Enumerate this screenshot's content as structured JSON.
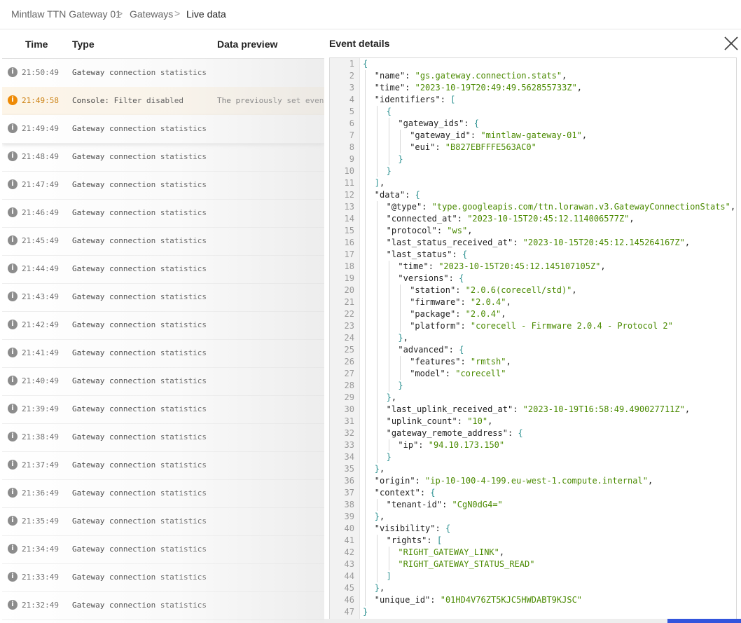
{
  "breadcrumb": {
    "items": [
      "Mintlaw TTN Gateway 01",
      "Gateways",
      "Live data"
    ],
    "separator": ">"
  },
  "table": {
    "columns": [
      "Time",
      "Type",
      "Data preview"
    ],
    "rows": [
      {
        "icon": "i",
        "time": "21:50:49",
        "type": "Gateway connection statistics",
        "preview": "",
        "state": "normal"
      },
      {
        "icon": "i",
        "time": "21:49:58",
        "type": "Console: Filter disabled",
        "preview": "The previously set event filter",
        "state": "warning"
      },
      {
        "icon": "i",
        "time": "21:49:49",
        "type": "Gateway connection statistics",
        "preview": "",
        "state": "selected"
      },
      {
        "icon": "i",
        "time": "21:48:49",
        "type": "Gateway connection statistics",
        "preview": "",
        "state": "normal"
      },
      {
        "icon": "i",
        "time": "21:47:49",
        "type": "Gateway connection statistics",
        "preview": "",
        "state": "normal"
      },
      {
        "icon": "i",
        "time": "21:46:49",
        "type": "Gateway connection statistics",
        "preview": "",
        "state": "normal"
      },
      {
        "icon": "i",
        "time": "21:45:49",
        "type": "Gateway connection statistics",
        "preview": "",
        "state": "normal"
      },
      {
        "icon": "i",
        "time": "21:44:49",
        "type": "Gateway connection statistics",
        "preview": "",
        "state": "normal"
      },
      {
        "icon": "i",
        "time": "21:43:49",
        "type": "Gateway connection statistics",
        "preview": "",
        "state": "normal"
      },
      {
        "icon": "i",
        "time": "21:42:49",
        "type": "Gateway connection statistics",
        "preview": "",
        "state": "normal"
      },
      {
        "icon": "i",
        "time": "21:41:49",
        "type": "Gateway connection statistics",
        "preview": "",
        "state": "normal"
      },
      {
        "icon": "i",
        "time": "21:40:49",
        "type": "Gateway connection statistics",
        "preview": "",
        "state": "normal"
      },
      {
        "icon": "i",
        "time": "21:39:49",
        "type": "Gateway connection statistics",
        "preview": "",
        "state": "normal"
      },
      {
        "icon": "i",
        "time": "21:38:49",
        "type": "Gateway connection statistics",
        "preview": "",
        "state": "normal"
      },
      {
        "icon": "i",
        "time": "21:37:49",
        "type": "Gateway connection statistics",
        "preview": "",
        "state": "normal"
      },
      {
        "icon": "i",
        "time": "21:36:49",
        "type": "Gateway connection statistics",
        "preview": "",
        "state": "normal"
      },
      {
        "icon": "i",
        "time": "21:35:49",
        "type": "Gateway connection statistics",
        "preview": "",
        "state": "normal"
      },
      {
        "icon": "i",
        "time": "21:34:49",
        "type": "Gateway connection statistics",
        "preview": "",
        "state": "normal"
      },
      {
        "icon": "i",
        "time": "21:33:49",
        "type": "Gateway connection statistics",
        "preview": "",
        "state": "normal"
      },
      {
        "icon": "i",
        "time": "21:32:49",
        "type": "Gateway connection statistics",
        "preview": "",
        "state": "normal"
      }
    ]
  },
  "panel": {
    "title": "Event details",
    "close_icon": "close-icon",
    "json_lines": [
      {
        "n": 1,
        "indent": 0,
        "t": [
          [
            "p",
            "{"
          ]
        ]
      },
      {
        "n": 2,
        "indent": 1,
        "t": [
          [
            "k",
            "\"name\""
          ],
          [
            "k",
            ": "
          ],
          [
            "s",
            "\"gs.gateway.connection.stats\""
          ],
          [
            "k",
            ","
          ]
        ]
      },
      {
        "n": 3,
        "indent": 1,
        "t": [
          [
            "k",
            "\"time\""
          ],
          [
            "k",
            ": "
          ],
          [
            "s",
            "\"2023-10-19T20:49:49.562855733Z\""
          ],
          [
            "k",
            ","
          ]
        ]
      },
      {
        "n": 4,
        "indent": 1,
        "t": [
          [
            "k",
            "\"identifiers\""
          ],
          [
            "k",
            ": "
          ],
          [
            "p",
            "["
          ]
        ]
      },
      {
        "n": 5,
        "indent": 2,
        "t": [
          [
            "p",
            "{"
          ]
        ]
      },
      {
        "n": 6,
        "indent": 3,
        "t": [
          [
            "k",
            "\"gateway_ids\""
          ],
          [
            "k",
            ": "
          ],
          [
            "p",
            "{"
          ]
        ]
      },
      {
        "n": 7,
        "indent": 4,
        "t": [
          [
            "k",
            "\"gateway_id\""
          ],
          [
            "k",
            ": "
          ],
          [
            "s",
            "\"mintlaw-gateway-01\""
          ],
          [
            "k",
            ","
          ]
        ]
      },
      {
        "n": 8,
        "indent": 4,
        "t": [
          [
            "k",
            "\"eui\""
          ],
          [
            "k",
            ": "
          ],
          [
            "s",
            "\"B827EBFFFE563AC0\""
          ]
        ]
      },
      {
        "n": 9,
        "indent": 3,
        "t": [
          [
            "p",
            "}"
          ]
        ]
      },
      {
        "n": 10,
        "indent": 2,
        "t": [
          [
            "p",
            "}"
          ]
        ]
      },
      {
        "n": 11,
        "indent": 1,
        "t": [
          [
            "p",
            "]"
          ],
          [
            "k",
            ","
          ]
        ]
      },
      {
        "n": 12,
        "indent": 1,
        "t": [
          [
            "k",
            "\"data\""
          ],
          [
            "k",
            ": "
          ],
          [
            "p",
            "{"
          ]
        ]
      },
      {
        "n": 13,
        "indent": 2,
        "t": [
          [
            "k",
            "\"@type\""
          ],
          [
            "k",
            ": "
          ],
          [
            "s",
            "\"type.googleapis.com/ttn.lorawan.v3.GatewayConnectionStats\""
          ],
          [
            "k",
            ","
          ]
        ]
      },
      {
        "n": 14,
        "indent": 2,
        "t": [
          [
            "k",
            "\"connected_at\""
          ],
          [
            "k",
            ": "
          ],
          [
            "s",
            "\"2023-10-15T20:45:12.114006577Z\""
          ],
          [
            "k",
            ","
          ]
        ]
      },
      {
        "n": 15,
        "indent": 2,
        "t": [
          [
            "k",
            "\"protocol\""
          ],
          [
            "k",
            ": "
          ],
          [
            "s",
            "\"ws\""
          ],
          [
            "k",
            ","
          ]
        ]
      },
      {
        "n": 16,
        "indent": 2,
        "t": [
          [
            "k",
            "\"last_status_received_at\""
          ],
          [
            "k",
            ": "
          ],
          [
            "s",
            "\"2023-10-15T20:45:12.145264167Z\""
          ],
          [
            "k",
            ","
          ]
        ]
      },
      {
        "n": 17,
        "indent": 2,
        "t": [
          [
            "k",
            "\"last_status\""
          ],
          [
            "k",
            ": "
          ],
          [
            "p",
            "{"
          ]
        ]
      },
      {
        "n": 18,
        "indent": 3,
        "t": [
          [
            "k",
            "\"time\""
          ],
          [
            "k",
            ": "
          ],
          [
            "s",
            "\"2023-10-15T20:45:12.145107105Z\""
          ],
          [
            "k",
            ","
          ]
        ]
      },
      {
        "n": 19,
        "indent": 3,
        "t": [
          [
            "k",
            "\"versions\""
          ],
          [
            "k",
            ": "
          ],
          [
            "p",
            "{"
          ]
        ]
      },
      {
        "n": 20,
        "indent": 4,
        "t": [
          [
            "k",
            "\"station\""
          ],
          [
            "k",
            ": "
          ],
          [
            "s",
            "\"2.0.6(corecell/std)\""
          ],
          [
            "k",
            ","
          ]
        ]
      },
      {
        "n": 21,
        "indent": 4,
        "t": [
          [
            "k",
            "\"firmware\""
          ],
          [
            "k",
            ": "
          ],
          [
            "s",
            "\"2.0.4\""
          ],
          [
            "k",
            ","
          ]
        ]
      },
      {
        "n": 22,
        "indent": 4,
        "t": [
          [
            "k",
            "\"package\""
          ],
          [
            "k",
            ": "
          ],
          [
            "s",
            "\"2.0.4\""
          ],
          [
            "k",
            ","
          ]
        ]
      },
      {
        "n": 23,
        "indent": 4,
        "t": [
          [
            "k",
            "\"platform\""
          ],
          [
            "k",
            ": "
          ],
          [
            "s",
            "\"corecell - Firmware 2.0.4 - Protocol 2\""
          ]
        ]
      },
      {
        "n": 24,
        "indent": 3,
        "t": [
          [
            "p",
            "}"
          ],
          [
            "k",
            ","
          ]
        ]
      },
      {
        "n": 25,
        "indent": 3,
        "t": [
          [
            "k",
            "\"advanced\""
          ],
          [
            "k",
            ": "
          ],
          [
            "p",
            "{"
          ]
        ]
      },
      {
        "n": 26,
        "indent": 4,
        "t": [
          [
            "k",
            "\"features\""
          ],
          [
            "k",
            ": "
          ],
          [
            "s",
            "\"rmtsh\""
          ],
          [
            "k",
            ","
          ]
        ]
      },
      {
        "n": 27,
        "indent": 4,
        "t": [
          [
            "k",
            "\"model\""
          ],
          [
            "k",
            ": "
          ],
          [
            "s",
            "\"corecell\""
          ]
        ]
      },
      {
        "n": 28,
        "indent": 3,
        "t": [
          [
            "p",
            "}"
          ]
        ]
      },
      {
        "n": 29,
        "indent": 2,
        "t": [
          [
            "p",
            "}"
          ],
          [
            "k",
            ","
          ]
        ]
      },
      {
        "n": 30,
        "indent": 2,
        "t": [
          [
            "k",
            "\"last_uplink_received_at\""
          ],
          [
            "k",
            ": "
          ],
          [
            "s",
            "\"2023-10-19T16:58:49.490027711Z\""
          ],
          [
            "k",
            ","
          ]
        ]
      },
      {
        "n": 31,
        "indent": 2,
        "t": [
          [
            "k",
            "\"uplink_count\""
          ],
          [
            "k",
            ": "
          ],
          [
            "s",
            "\"10\""
          ],
          [
            "k",
            ","
          ]
        ]
      },
      {
        "n": 32,
        "indent": 2,
        "t": [
          [
            "k",
            "\"gateway_remote_address\""
          ],
          [
            "k",
            ": "
          ],
          [
            "p",
            "{"
          ]
        ]
      },
      {
        "n": 33,
        "indent": 3,
        "t": [
          [
            "k",
            "\"ip\""
          ],
          [
            "k",
            ": "
          ],
          [
            "s",
            "\"94.10.173.150\""
          ]
        ]
      },
      {
        "n": 34,
        "indent": 2,
        "t": [
          [
            "p",
            "}"
          ]
        ]
      },
      {
        "n": 35,
        "indent": 1,
        "t": [
          [
            "p",
            "}"
          ],
          [
            "k",
            ","
          ]
        ]
      },
      {
        "n": 36,
        "indent": 1,
        "t": [
          [
            "k",
            "\"origin\""
          ],
          [
            "k",
            ": "
          ],
          [
            "s",
            "\"ip-10-100-4-199.eu-west-1.compute.internal\""
          ],
          [
            "k",
            ","
          ]
        ]
      },
      {
        "n": 37,
        "indent": 1,
        "t": [
          [
            "k",
            "\"context\""
          ],
          [
            "k",
            ": "
          ],
          [
            "p",
            "{"
          ]
        ]
      },
      {
        "n": 38,
        "indent": 2,
        "t": [
          [
            "k",
            "\"tenant-id\""
          ],
          [
            "k",
            ": "
          ],
          [
            "s",
            "\"CgN0dG4=\""
          ]
        ]
      },
      {
        "n": 39,
        "indent": 1,
        "t": [
          [
            "p",
            "}"
          ],
          [
            "k",
            ","
          ]
        ]
      },
      {
        "n": 40,
        "indent": 1,
        "t": [
          [
            "k",
            "\"visibility\""
          ],
          [
            "k",
            ": "
          ],
          [
            "p",
            "{"
          ]
        ]
      },
      {
        "n": 41,
        "indent": 2,
        "t": [
          [
            "k",
            "\"rights\""
          ],
          [
            "k",
            ": "
          ],
          [
            "p",
            "["
          ]
        ]
      },
      {
        "n": 42,
        "indent": 3,
        "t": [
          [
            "s",
            "\"RIGHT_GATEWAY_LINK\""
          ],
          [
            "k",
            ","
          ]
        ]
      },
      {
        "n": 43,
        "indent": 3,
        "t": [
          [
            "s",
            "\"RIGHT_GATEWAY_STATUS_READ\""
          ]
        ]
      },
      {
        "n": 44,
        "indent": 2,
        "t": [
          [
            "p",
            "]"
          ]
        ]
      },
      {
        "n": 45,
        "indent": 1,
        "t": [
          [
            "p",
            "}"
          ],
          [
            "k",
            ","
          ]
        ]
      },
      {
        "n": 46,
        "indent": 1,
        "t": [
          [
            "k",
            "\"unique_id\""
          ],
          [
            "k",
            ": "
          ],
          [
            "s",
            "\"01HD4V76ZT5KJC5HWDABT9KJSC\""
          ]
        ]
      },
      {
        "n": 47,
        "indent": 0,
        "t": [
          [
            "p",
            "}"
          ]
        ]
      }
    ]
  },
  "colors": {
    "json_string": "#4a8a00",
    "json_bracket": "#2a9090",
    "warning_accent": "#ee8800",
    "info_icon": "#8a8a8a",
    "scroll_accent": "#3355dd"
  }
}
